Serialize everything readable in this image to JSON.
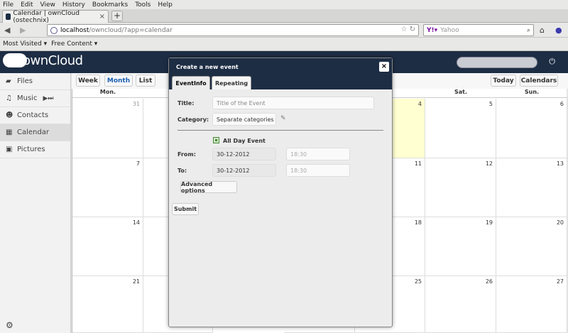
{
  "browser": {
    "menu": [
      "File",
      "Edit",
      "View",
      "History",
      "Bookmarks",
      "Tools",
      "Help"
    ],
    "tab_title": "Calendar | ownCloud (ostechnix)",
    "url_host": "localhost",
    "url_path": "/owncloud/?app=calendar",
    "search_placeholder": "Yahoo",
    "bookmarks": [
      "Most Visited ▾",
      "Free Content ▾"
    ]
  },
  "app": {
    "logo": "ownCloud"
  },
  "sidebar": {
    "items": [
      {
        "label": "Files",
        "icon": "folder-icon"
      },
      {
        "label": "Music",
        "icon": "music-icon"
      },
      {
        "label": "Contacts",
        "icon": "contacts-icon"
      },
      {
        "label": "Calendar",
        "icon": "calendar-icon"
      },
      {
        "label": "Pictures",
        "icon": "pictures-icon"
      }
    ]
  },
  "toolbar": {
    "week": "Week",
    "month": "Month",
    "list": "List",
    "today": "Today",
    "calendars": "Calendars"
  },
  "calendar": {
    "day_headers": {
      "mon": "Mon.",
      "sat": "Sat.",
      "sun": "Sun."
    },
    "weeks": [
      {
        "mon": "31",
        "col5": "4",
        "sat": "5",
        "sun": "6"
      },
      {
        "mon": "7",
        "col5": "11",
        "sat": "12",
        "sun": "13"
      },
      {
        "mon": "14",
        "col5": "18",
        "sat": "19",
        "sun": "20"
      },
      {
        "mon": "21",
        "col5": "25",
        "sat": "26",
        "sun": "27"
      }
    ]
  },
  "dialog": {
    "title": "Create a new event",
    "close": "×",
    "tabs": [
      "EventInfo",
      "Repeating"
    ],
    "title_label": "Title:",
    "title_placeholder": "Title of the Event",
    "category_label": "Category:",
    "category_value": "Separate categories w",
    "all_day_label": "All Day Event",
    "from_label": "From:",
    "from_date": "30-12-2012",
    "from_time": "18:30",
    "to_label": "To:",
    "to_date": "30-12-2012",
    "to_time": "18:30",
    "advanced": "Advanced options",
    "submit": "Submit"
  }
}
